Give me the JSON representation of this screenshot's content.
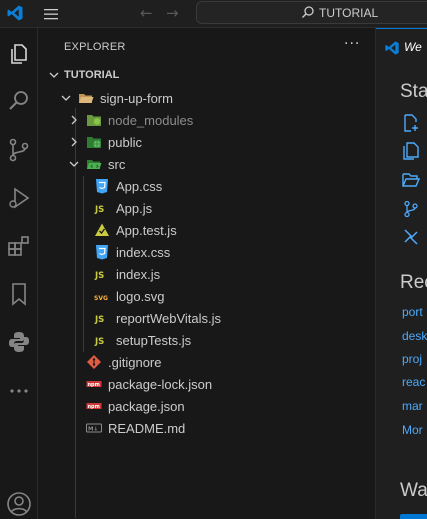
{
  "titlebar": {
    "search_text": "TUTORIAL",
    "icons": [
      "vscode-logo-icon",
      "hamburger-menu-icon",
      "arrow-left-icon",
      "arrow-right-icon",
      "search-icon"
    ]
  },
  "activitybar": {
    "items": [
      "explorer",
      "search",
      "source-control",
      "run-and-debug",
      "extensions",
      "bookmarks",
      "python",
      "more",
      "accounts"
    ]
  },
  "explorer": {
    "title": "EXPLORER",
    "more": "···",
    "section": "TUTORIAL",
    "tree": [
      {
        "name": "sign-up-form",
        "type": "folder-open"
      },
      {
        "name": "node_modules",
        "type": "folder-closed"
      },
      {
        "name": "public",
        "type": "folder-closed"
      },
      {
        "name": "src",
        "type": "folder-open"
      },
      {
        "name": "App.css",
        "type": "css"
      },
      {
        "name": "App.js",
        "type": "js"
      },
      {
        "name": "App.test.js",
        "type": "test-js"
      },
      {
        "name": "index.css",
        "type": "css"
      },
      {
        "name": "index.js",
        "type": "js"
      },
      {
        "name": "logo.svg",
        "type": "svg"
      },
      {
        "name": "reportWebVitals.js",
        "type": "js"
      },
      {
        "name": "setupTests.js",
        "type": "js"
      },
      {
        "name": ".gitignore",
        "type": "git"
      },
      {
        "name": "package-lock.json",
        "type": "npm"
      },
      {
        "name": "package.json",
        "type": "npm"
      },
      {
        "name": "README.md",
        "type": "md"
      }
    ]
  },
  "editor": {
    "tab_label": "We",
    "start_heading": "Sta",
    "recent_heading": "Rec",
    "recent_items": [
      "port",
      "desk",
      "proj",
      "reac",
      "mar",
      "Mor"
    ],
    "walkthrough_heading": "Wa"
  },
  "colors": {
    "accent": "#0078d4",
    "link": "#4daafc",
    "js": "#cbcb41",
    "css": "#42a5f5",
    "npm": "#cb3837",
    "git": "#e05d44"
  }
}
